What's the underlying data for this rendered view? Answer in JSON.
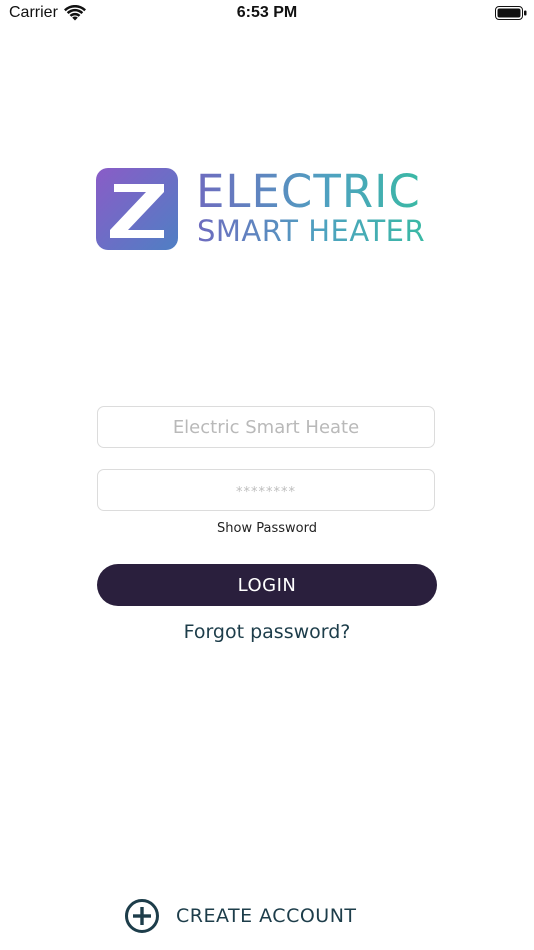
{
  "status_bar": {
    "carrier": "Carrier",
    "time": "6:53 PM",
    "icons": [
      "wifi-icon",
      "battery-icon"
    ]
  },
  "logo": {
    "line1": "ELECTRIC",
    "line2": "SMART HEATER",
    "colors": {
      "mark_start": "#8a5cc7",
      "mark_end": "#4f7fc4",
      "text_start": "#6e6bbf",
      "text_end": "#3ab9a4"
    }
  },
  "form": {
    "username": {
      "value": "",
      "placeholder": "Electric Smart Heate"
    },
    "password": {
      "value": "",
      "placeholder": "********"
    },
    "show_password_label": "Show Password",
    "login_label": "LOGIN",
    "forgot_password_label": "Forgot password?"
  },
  "footer": {
    "create_account_label": "CREATE ACCOUNT",
    "icon": "plus-circle-icon"
  },
  "colors": {
    "login_button_bg": "#2a1f3d",
    "link_text": "#1d3d4a",
    "field_border": "#dcdcdc"
  }
}
